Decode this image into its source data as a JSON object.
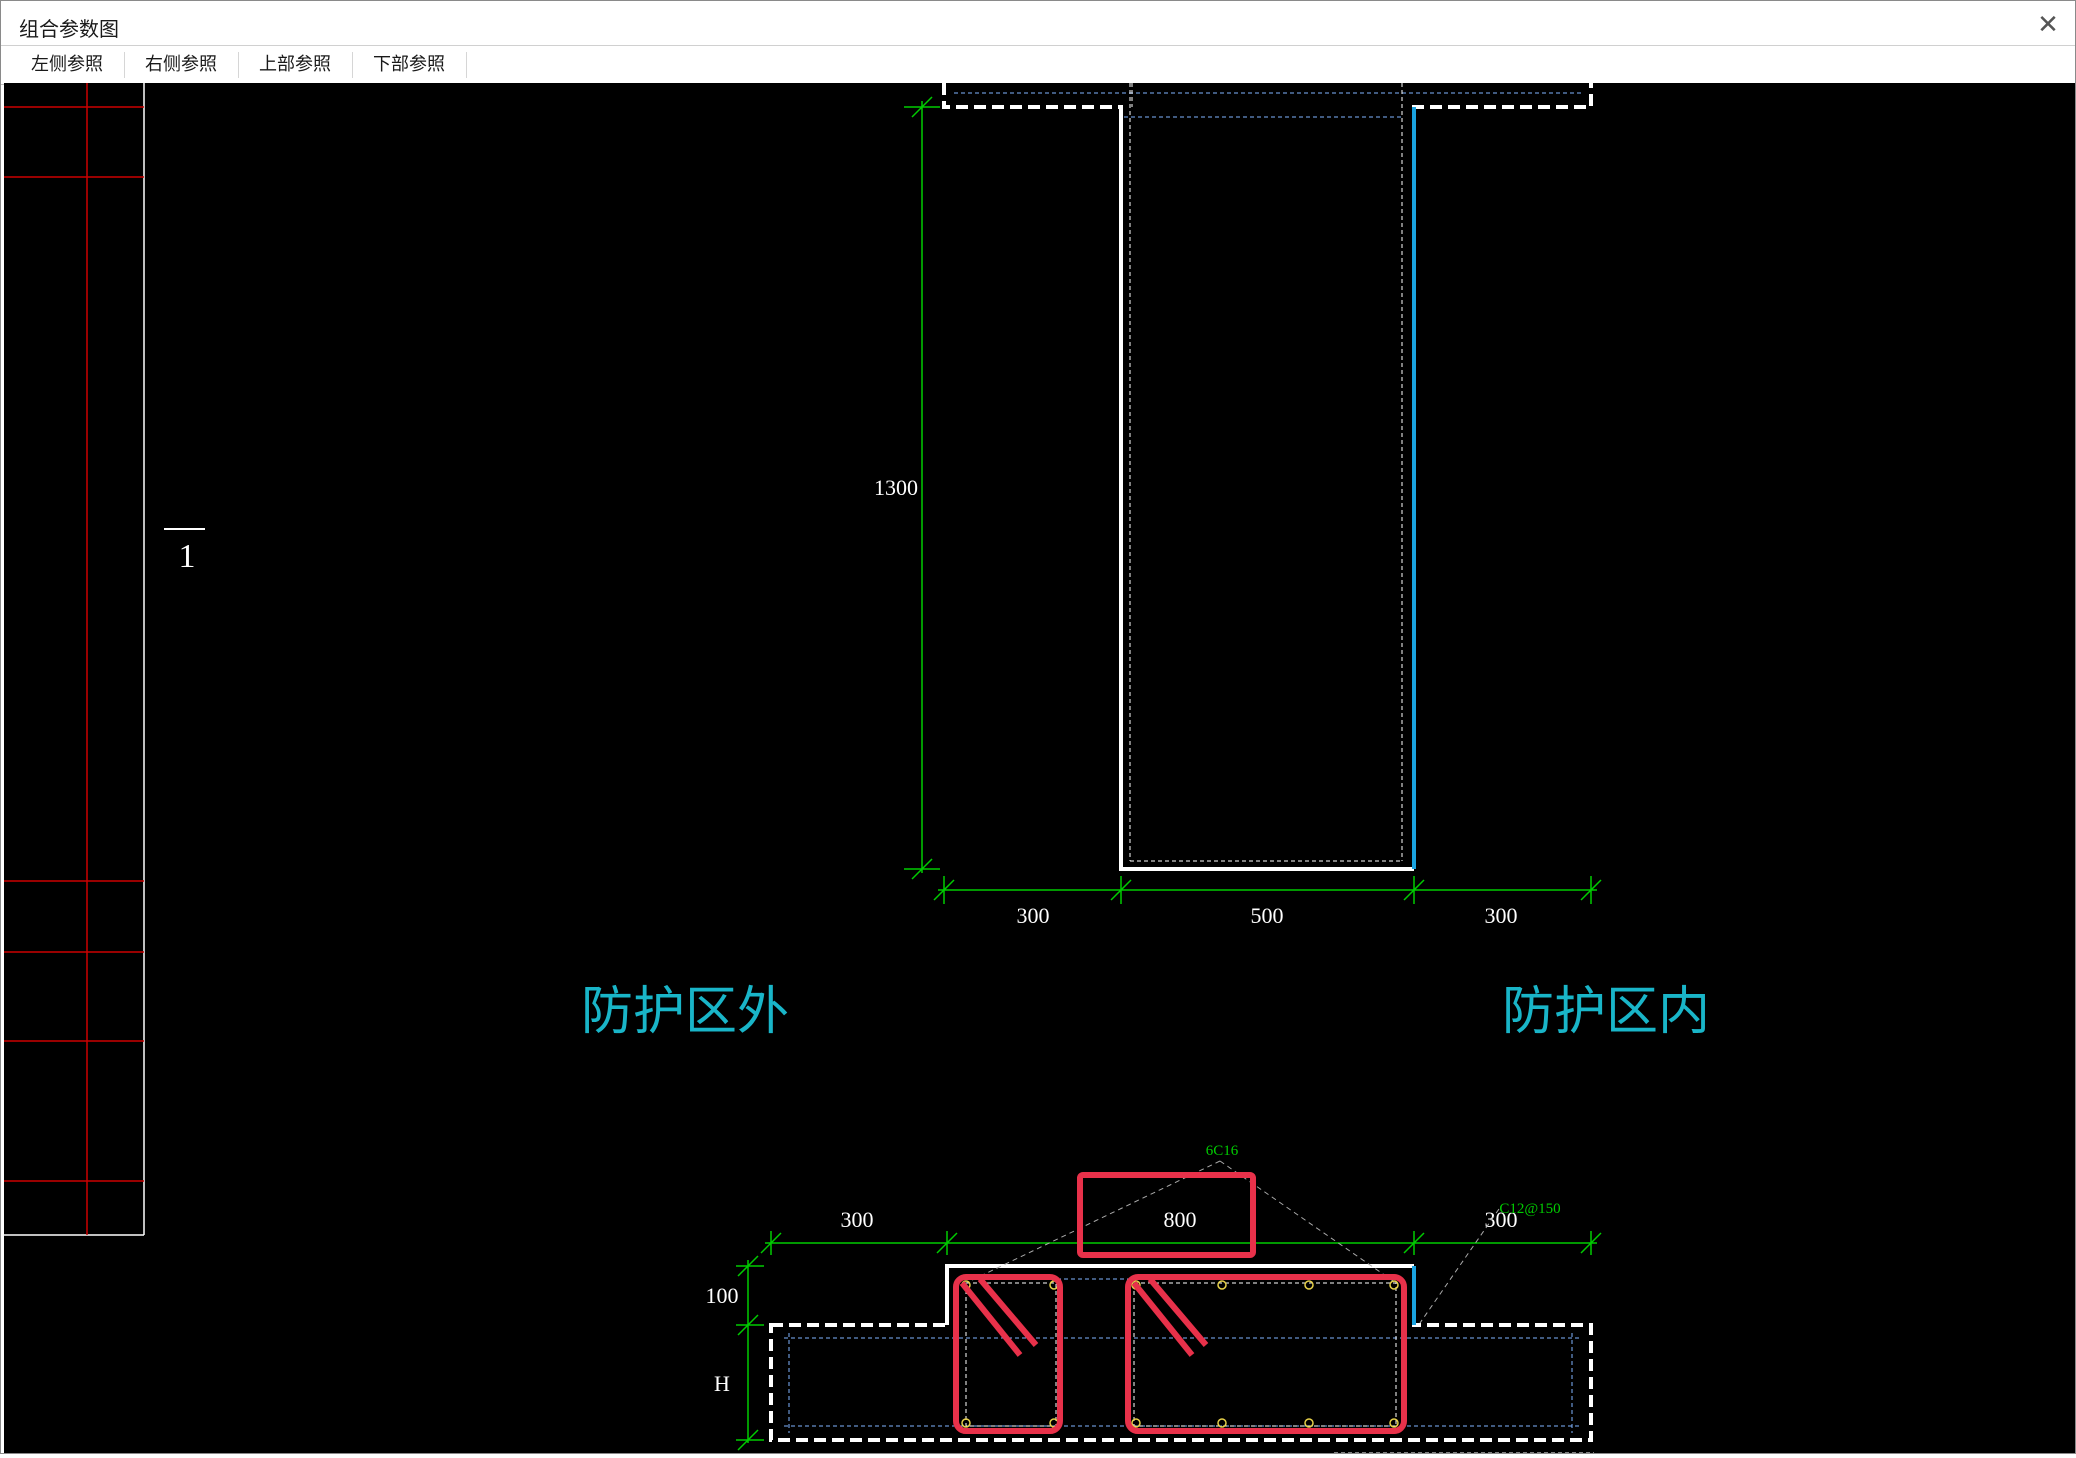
{
  "window": {
    "title": "组合参数图"
  },
  "toolbar": {
    "buttons": [
      {
        "label": "左侧参照"
      },
      {
        "label": "右侧参照"
      },
      {
        "label": "上部参照"
      },
      {
        "label": "下部参照"
      }
    ]
  },
  "drawing": {
    "section_mark": "1",
    "label_outside": "防护区外",
    "label_inside": "防护区内",
    "top_dims": {
      "height": "1300",
      "left": "300",
      "middle": "500",
      "right": "300"
    },
    "bottom_dims": {
      "left": "300",
      "middle": "800",
      "right": "300",
      "slab": "100",
      "height_var": "H"
    },
    "rebar_labels": {
      "main": "6C16",
      "stirrup": "C12@150"
    },
    "colors": {
      "dimension": "#00cc00",
      "outline": "#ffffff",
      "protected_face": "#1aa3e0",
      "grid": "#cc0000",
      "label_text": "#19b5c8",
      "highlight": "#e8314a"
    }
  }
}
